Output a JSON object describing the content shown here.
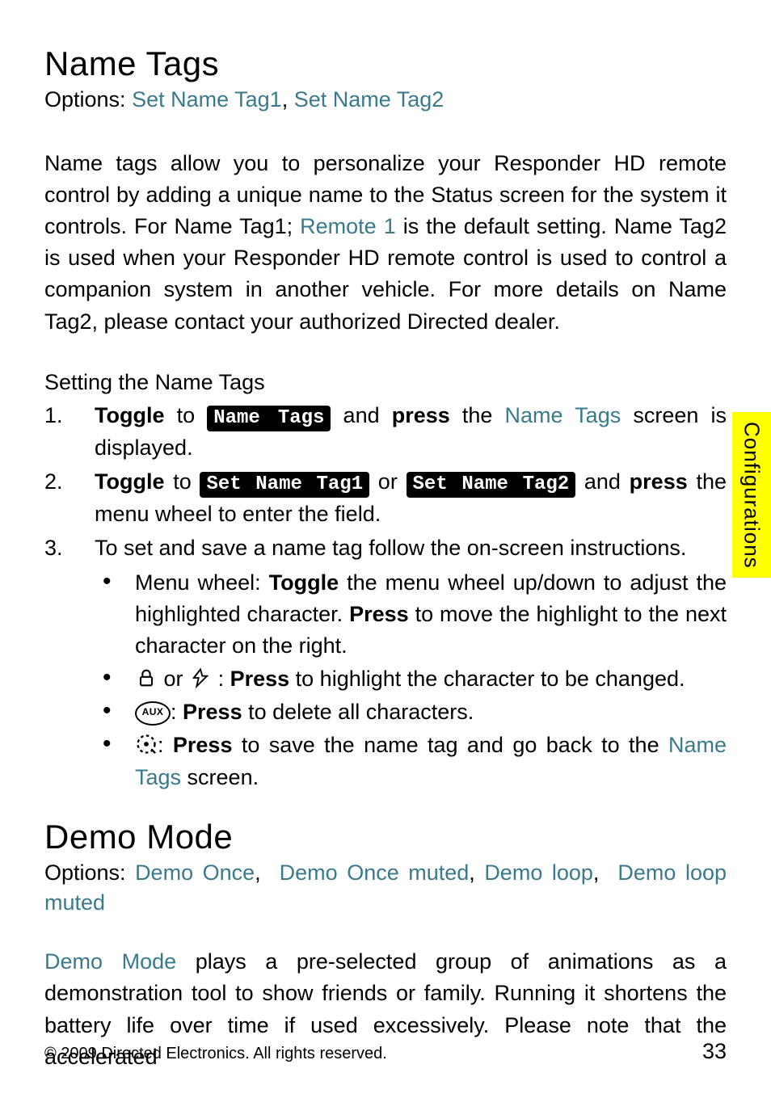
{
  "side_tab": "Configurations",
  "section1": {
    "title": "Name Tags",
    "options_prefix": "Options: ",
    "option1": "Set Name Tag1",
    "option2": "Set Name Tag2",
    "body_a": "Name tags allow you to personalize your Responder HD remote control by adding a unique name to the Status screen for the system it controls. For Name Tag1; ",
    "body_remote": "Remote 1",
    "body_b": " is the default setting. Name Tag2 is used when your Responder HD remote control is used to control a companion system in another vehicle.  For more details on Name Tag2, please contact your authorized Directed dealer.",
    "sub_heading": "Setting the Name Tags",
    "step1": {
      "a": "Toggle",
      "b": " to ",
      "chip": "Name Tags",
      "c": " and ",
      "d": "press",
      "e": " the ",
      "link": "Name Tags",
      "f": " screen is displayed."
    },
    "step2": {
      "a": "Toggle",
      "b": " to ",
      "chip1": "Set Name Tag1",
      "c": " or ",
      "chip2": "Set Name Tag2",
      "d": " and ",
      "e": "press",
      "f": " the menu wheel to enter the field."
    },
    "step3": {
      "intro": "To set and save a name tag follow the on-screen instructions.",
      "b1a": "Menu wheel: ",
      "b1b": "Toggle",
      "b1c": " the menu wheel up/down to adjust the highlighted character. ",
      "b1d": "Press",
      "b1e": " to move the highlight to the next character on the right.",
      "b2or": "or",
      "b2a": ": ",
      "b2b": "Press",
      "b2c": " to highlight the character to be changed.",
      "b3label": "AUX",
      "b3a": ": ",
      "b3b": "Press",
      "b3c": " to delete all characters.",
      "b4a": ": ",
      "b4b": "Press",
      "b4c": " to save the name tag and go back to the ",
      "b4link": "Name Tags",
      "b4d": " screen."
    }
  },
  "section2": {
    "title": "Demo Mode",
    "options_prefix": "Options: ",
    "opt1": "Demo Once",
    "opt2": "Demo Once muted",
    "opt3": "Demo loop",
    "opt4": "Demo loop muted",
    "body_link": "Demo Mode",
    "body_rest": " plays a pre-selected group of animations as a demonstration tool to show friends or family. Running it shortens the battery life over time if used excessively. Please note that the accelerated"
  },
  "footer": {
    "copyright": "© 2009 Directed Electronics. All rights reserved.",
    "page": "33"
  }
}
